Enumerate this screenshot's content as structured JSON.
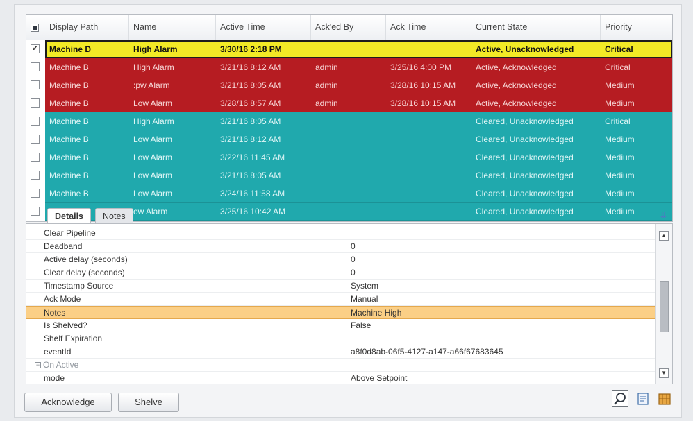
{
  "table": {
    "columns": [
      "Display Path",
      "Name",
      "Active Time",
      "Ack'ed By",
      "Ack Time",
      "Current State",
      "Priority"
    ],
    "rows": [
      {
        "checked": true,
        "style": "sel",
        "cells": [
          "Machine D",
          "High Alarm",
          "3/30/16 2:18 PM",
          "",
          "",
          "Active, Unacknowledged",
          "Critical"
        ]
      },
      {
        "checked": false,
        "style": "red",
        "cells": [
          "Machine B",
          "High Alarm",
          "3/21/16 8:12 AM",
          "admin",
          "3/25/16 4:00 PM",
          "Active, Acknowledged",
          "Critical"
        ]
      },
      {
        "checked": false,
        "style": "red",
        "cells": [
          "Machine B",
          ":pw Alarm",
          "3/21/16 8:05 AM",
          "admin",
          "3/28/16 10:15 AM",
          "Active, Acknowledged",
          "Medium"
        ]
      },
      {
        "checked": false,
        "style": "red",
        "cells": [
          "Machine B",
          "Low Alarm",
          "3/28/16 8:57 AM",
          "admin",
          "3/28/16 10:15 AM",
          "Active, Acknowledged",
          "Medium"
        ]
      },
      {
        "checked": false,
        "style": "teal",
        "cells": [
          "Machine B",
          "High Alarm",
          "3/21/16 8:05 AM",
          "",
          "",
          "Cleared, Unacknowledged",
          "Critical"
        ]
      },
      {
        "checked": false,
        "style": "teal",
        "cells": [
          "Machine B",
          "Low Alarm",
          "3/21/16 8:12 AM",
          "",
          "",
          "Cleared, Unacknowledged",
          "Medium"
        ]
      },
      {
        "checked": false,
        "style": "teal",
        "cells": [
          "Machine B",
          "Low Alarm",
          "3/22/16 11:45 AM",
          "",
          "",
          "Cleared, Unacknowledged",
          "Medium"
        ]
      },
      {
        "checked": false,
        "style": "teal",
        "cells": [
          "Machine B",
          "Low Alarm",
          "3/21/16 8:05 AM",
          "",
          "",
          "Cleared, Unacknowledged",
          "Medium"
        ]
      },
      {
        "checked": false,
        "style": "teal",
        "cells": [
          "Machine B",
          "Low Alarm",
          "3/24/16 11:58 AM",
          "",
          "",
          "Cleared, Unacknowledged",
          "Medium"
        ]
      },
      {
        "checked": false,
        "style": "teal",
        "cells": [
          "",
          "ow Alarm",
          "3/25/16 10:42 AM",
          "",
          "",
          "Cleared, Unacknowledged",
          "Medium"
        ]
      }
    ]
  },
  "tabs": {
    "details": "Details",
    "notes": "Notes"
  },
  "details": {
    "rows": [
      {
        "key": "Clear Pipeline",
        "value": ""
      },
      {
        "key": "Deadband",
        "value": "0"
      },
      {
        "key": "Active delay (seconds)",
        "value": "0"
      },
      {
        "key": "Clear delay (seconds)",
        "value": "0"
      },
      {
        "key": "Timestamp Source",
        "value": "System"
      },
      {
        "key": "Ack Mode",
        "value": "Manual"
      },
      {
        "key": "Notes",
        "value": "Machine High",
        "highlight": true
      },
      {
        "key": "Is Shelved?",
        "value": "False"
      },
      {
        "key": "Shelf Expiration",
        "value": ""
      },
      {
        "key": "eventId",
        "value": "a8f0d8ab-06f5-4127-a147-a66f67683645"
      },
      {
        "key": "On Active",
        "value": "",
        "group": true
      },
      {
        "key": "mode",
        "value": "Above Setpoint"
      }
    ]
  },
  "buttons": {
    "acknowledge": "Acknowledge",
    "shelve": "Shelve"
  },
  "colors": {
    "selected_row": "#f2ea26",
    "active_row": "#b61c22",
    "cleared_row": "#20a9ad",
    "highlight_detail": "#fbcf86"
  },
  "icons": [
    "magnifier-icon",
    "edit-note-icon",
    "shelve-icon"
  ]
}
